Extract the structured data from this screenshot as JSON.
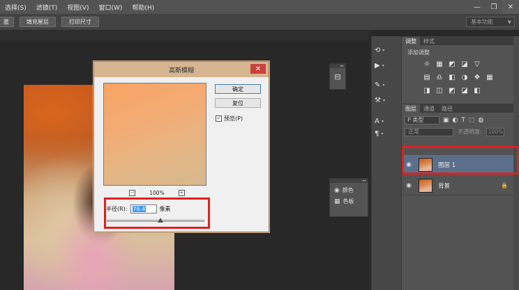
{
  "menubar": {
    "items": [
      "选择(S)",
      "滤镜(T)",
      "视图(V)",
      "窗口(W)",
      "帮助(H)"
    ],
    "window_buttons": [
      "—",
      "❐",
      "✕"
    ]
  },
  "options_bar": {
    "buttons": [
      "匿",
      "填充屋层",
      "打印尺寸"
    ],
    "workspace": "基本功能"
  },
  "dialog": {
    "title": "高斯模糊",
    "close_glyph": "✕",
    "ok_label": "确定",
    "reset_label": "复位",
    "preview_label": "预览(P)",
    "preview_checked": true,
    "zoom_out": "−",
    "zoom_in": "+",
    "zoom_value": "100%",
    "radius_label": "半径(R):",
    "radius_value": "76.4",
    "radius_unit": "像素",
    "slider_fraction": 0.55
  },
  "float_tool": {
    "icon": "info-icon",
    "glyph": "⊟"
  },
  "float_panel": {
    "items": [
      {
        "icon": "color-icon",
        "glyph": "◉",
        "label": "颜色"
      },
      {
        "icon": "swatches-icon",
        "glyph": "▦",
        "label": "色板"
      }
    ]
  },
  "dock": {
    "buttons": [
      {
        "icon": "history-icon",
        "glyph": "⟲"
      },
      {
        "icon": "actions-icon",
        "glyph": "▶"
      },
      {
        "icon": "brush-icon",
        "glyph": "✎"
      },
      {
        "icon": "tool-presets-icon",
        "glyph": "⚒"
      },
      {
        "icon": "character-icon",
        "glyph": "A"
      },
      {
        "icon": "paragraph-icon",
        "glyph": "¶"
      }
    ]
  },
  "adjustments": {
    "tabs": [
      "调整",
      "样式"
    ],
    "title": "添加调整",
    "rows": [
      [
        "☼",
        "▦",
        "◩",
        "◪",
        "▽"
      ],
      [
        "▤",
        "♎",
        "◧",
        "◑",
        "❖",
        "▦"
      ],
      [
        "◨",
        "◫",
        "◩",
        "◪",
        "◧"
      ]
    ]
  },
  "layers_panel": {
    "tabs": [
      "图层",
      "通道",
      "路径"
    ],
    "kind_filter": "P 类型",
    "filter_icons": [
      "▣",
      "◐",
      "T",
      "⬚",
      "◍"
    ],
    "blend_mode": "正常",
    "opacity_label": "不透明度:",
    "opacity_value": "100%",
    "layers": [
      {
        "name": "图层 1",
        "selected": true,
        "locked": false
      },
      {
        "name": "背景",
        "selected": false,
        "locked": true
      }
    ]
  }
}
